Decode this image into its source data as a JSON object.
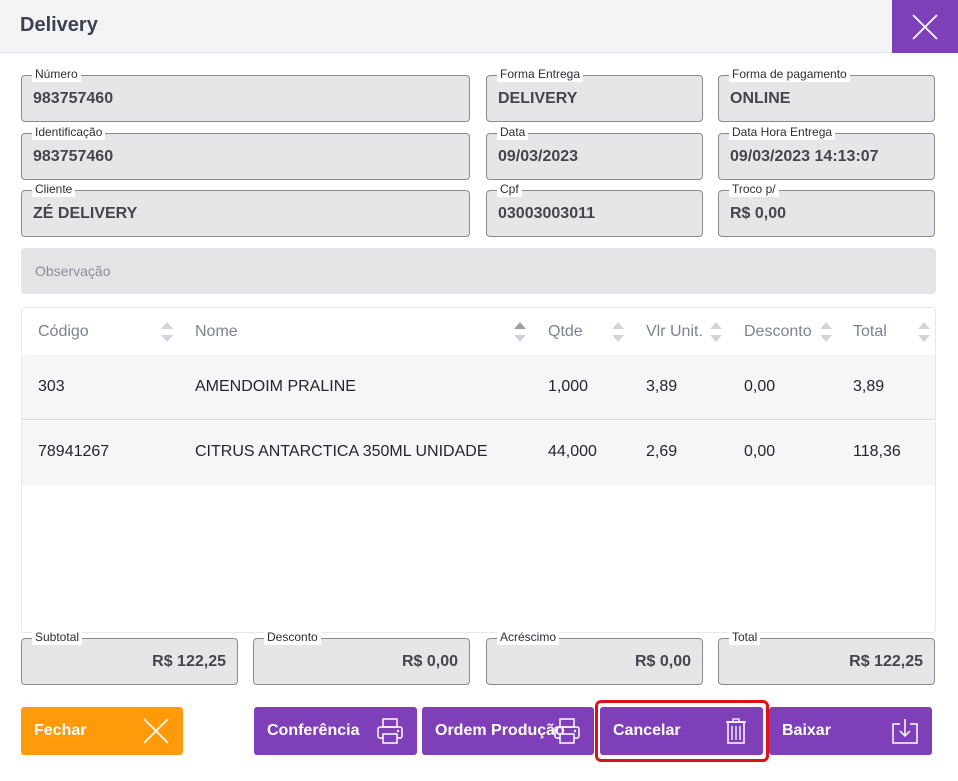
{
  "window": {
    "title": "Delivery"
  },
  "fields": {
    "numero": {
      "label": "Número",
      "value": "983757460"
    },
    "forma_entrega": {
      "label": "Forma Entrega",
      "value": "DELIVERY"
    },
    "forma_pagamento": {
      "label": "Forma de pagamento",
      "value": "ONLINE"
    },
    "identificacao": {
      "label": "Identificação",
      "value": "983757460"
    },
    "data": {
      "label": "Data",
      "value": "09/03/2023"
    },
    "data_hora_entrega": {
      "label": "Data Hora Entrega",
      "value": "09/03/2023 14:13:07"
    },
    "cliente": {
      "label": "Cliente",
      "value": "ZÉ DELIVERY"
    },
    "cpf": {
      "label": "Cpf",
      "value": "03003003011"
    },
    "troco": {
      "label": "Troco p/",
      "value": "R$ 0,00"
    },
    "observacao": {
      "placeholder": "Observação"
    }
  },
  "table": {
    "columns": [
      "Código",
      "Nome",
      "Qtde",
      "Vlr Unit.",
      "Desconto",
      "Total"
    ],
    "rows": [
      [
        "303",
        "AMENDOIM PRALINE",
        "1,000",
        "3,89",
        "0,00",
        "3,89"
      ],
      [
        "78941267",
        "CITRUS ANTARCTICA 350ML UNIDADE",
        "44,000",
        "2,69",
        "0,00",
        "118,36"
      ]
    ]
  },
  "totals": {
    "subtotal": {
      "label": "Subtotal",
      "value": "R$ 122,25"
    },
    "desconto": {
      "label": "Desconto",
      "value": "R$ 0,00"
    },
    "acrescimo": {
      "label": "Acréscimo",
      "value": "R$ 0,00"
    },
    "total": {
      "label": "Total",
      "value": "R$ 122,25"
    }
  },
  "buttons": {
    "fechar": "Fechar",
    "conferencia": "Conferência",
    "ordem_producao": "Ordem Produção",
    "cancelar": "Cancelar",
    "baixar": "Baixar"
  },
  "icons": {
    "close": "close-icon",
    "fechar": "close-icon",
    "conferencia": "printer-icon",
    "ordem_producao": "printer-icon",
    "cancelar": "trash-icon",
    "baixar": "download-icon"
  },
  "colors": {
    "accent_purple": "#7e3fb8",
    "accent_orange": "#ff9a0a",
    "highlight_red": "#e0101a"
  }
}
